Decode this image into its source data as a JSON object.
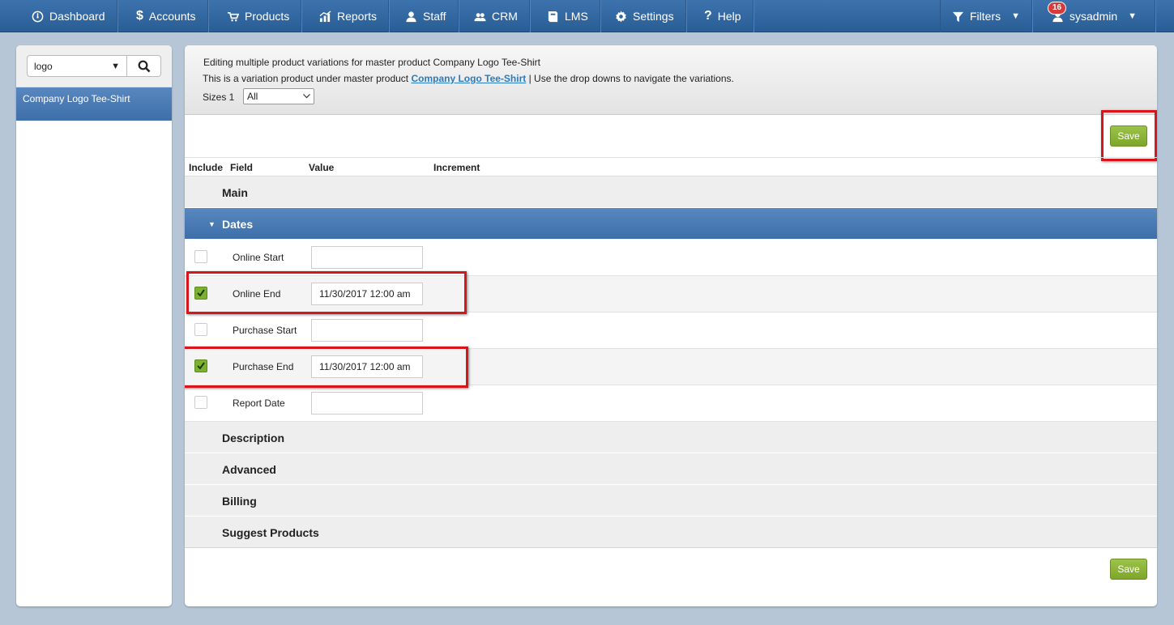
{
  "nav": {
    "items": [
      {
        "label": "Dashboard",
        "icon": "dashboard-icon"
      },
      {
        "label": "Accounts",
        "icon": "dollar-icon"
      },
      {
        "label": "Products",
        "icon": "cart-icon"
      },
      {
        "label": "Reports",
        "icon": "chart-icon"
      },
      {
        "label": "Staff",
        "icon": "user-icon"
      },
      {
        "label": "CRM",
        "icon": "users-icon"
      },
      {
        "label": "LMS",
        "icon": "book-icon"
      },
      {
        "label": "Settings",
        "icon": "gear-icon"
      },
      {
        "label": "Help",
        "icon": "question-icon"
      }
    ],
    "filters_label": "Filters",
    "user": {
      "name": "sysadmin",
      "badge": "16"
    }
  },
  "sidebar": {
    "search_value": "logo",
    "results": [
      {
        "label": "Company Logo Tee-Shirt"
      }
    ]
  },
  "header": {
    "title": "Editing multiple product variations for master product Company Logo Tee-Shirt",
    "subtitle_prefix": "This is a variation product under master product",
    "master_link": "Company Logo Tee-Shirt",
    "subtitle_suffix": "|  Use the drop downs to navigate the variations.",
    "sizes_label": "Sizes 1",
    "sizes_value": "All"
  },
  "save_label": "Save",
  "columns": {
    "include": "Include",
    "field": "Field",
    "value": "Value",
    "increment": "Increment"
  },
  "sections": {
    "main": "Main",
    "dates": "Dates",
    "description": "Description",
    "advanced": "Advanced",
    "billing": "Billing",
    "suggest": "Suggest Products"
  },
  "date_fields": [
    {
      "label": "Online Start",
      "value": "",
      "checked": false
    },
    {
      "label": "Online End",
      "value": "11/30/2017 12:00 am",
      "checked": true
    },
    {
      "label": "Purchase Start",
      "value": "",
      "checked": false
    },
    {
      "label": "Purchase End",
      "value": "11/30/2017 12:00 am",
      "checked": true
    },
    {
      "label": "Report Date",
      "value": "",
      "checked": false
    }
  ],
  "colors": {
    "nav": "#2f66a0",
    "accent_blue": "#4a7bb5",
    "save_green": "#8bb43a",
    "highlight_red": "#d9141b"
  }
}
